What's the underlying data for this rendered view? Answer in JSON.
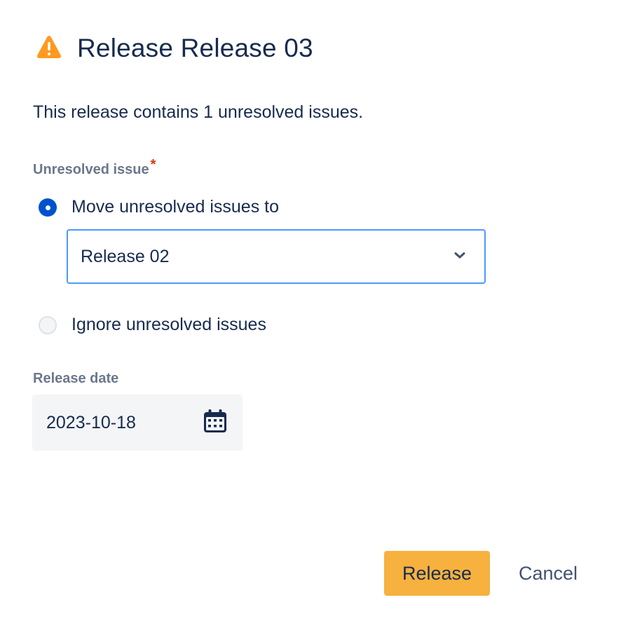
{
  "dialog": {
    "title": "Release Release 03",
    "icon": "warning-icon",
    "description": "This release contains 1 unresolved issues."
  },
  "unresolved": {
    "label": "Unresolved issue",
    "required_marker": "*",
    "options": [
      {
        "label": "Move unresolved issues to",
        "selected": true
      },
      {
        "label": "Ignore unresolved issues",
        "selected": false
      }
    ],
    "target_version": "Release 02"
  },
  "release_date": {
    "label": "Release date",
    "value": "2023-10-18",
    "icon": "calendar-icon"
  },
  "actions": {
    "release_label": "Release",
    "cancel_label": "Cancel"
  },
  "colors": {
    "accent": "#0052cc",
    "warning": "#ff991f",
    "primary_button": "#f6b13e",
    "focus_border": "#4c9aff",
    "required": "#de350b"
  }
}
